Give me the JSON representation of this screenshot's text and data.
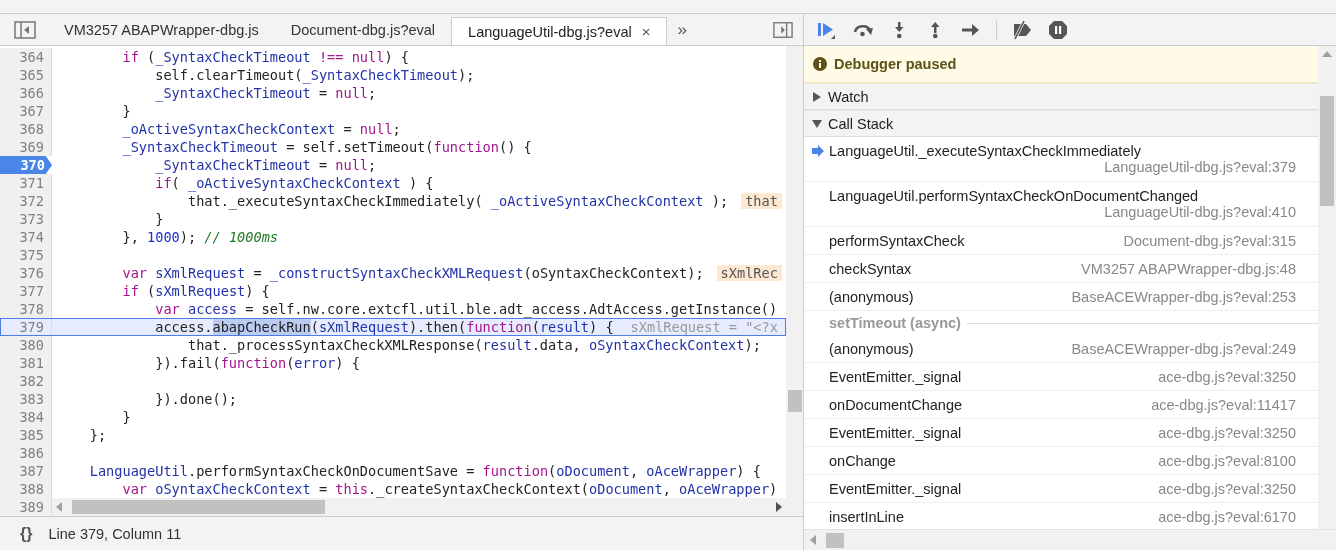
{
  "editor_tabs": [
    {
      "label": "VM3257 ABAPWrapper-dbg.js",
      "selected": false
    },
    {
      "label": "Document-dbg.js?eval",
      "selected": false
    },
    {
      "label": "LanguageUtil-dbg.js?eval",
      "selected": true,
      "close": "×"
    }
  ],
  "more_tabs": "»",
  "code": [
    {
      "number": "364",
      "breakpoint": false,
      "current": false,
      "segments": [
        {
          "text": "        if",
          "kind": "keyword"
        },
        {
          "text": " (",
          "kind": "plain"
        },
        {
          "text": "_SyntaxCheckTimeout",
          "kind": "variable"
        },
        {
          "text": " !== null",
          "kind": "keyword"
        },
        {
          "text": ") {",
          "kind": "plain"
        }
      ]
    },
    {
      "number": "365",
      "breakpoint": false,
      "current": false,
      "segments": [
        {
          "text": "            self.clearTimeout(",
          "kind": "plain"
        },
        {
          "text": "_SyntaxCheckTimeout",
          "kind": "variable"
        },
        {
          "text": ");",
          "kind": "plain"
        }
      ]
    },
    {
      "number": "366",
      "breakpoint": false,
      "current": false,
      "segments": [
        {
          "text": "            _SyntaxCheckTimeout",
          "kind": "variable"
        },
        {
          "text": " = ",
          "kind": "plain"
        },
        {
          "text": "null",
          "kind": "keyword"
        },
        {
          "text": ";",
          "kind": "plain"
        }
      ]
    },
    {
      "number": "367",
      "breakpoint": false,
      "current": false,
      "segments": [
        {
          "text": "        }",
          "kind": "plain"
        }
      ]
    },
    {
      "number": "368",
      "breakpoint": false,
      "current": false,
      "segments": [
        {
          "text": "        _oActiveSyntaxCheckContext",
          "kind": "variable"
        },
        {
          "text": " = ",
          "kind": "plain"
        },
        {
          "text": "null",
          "kind": "keyword"
        },
        {
          "text": ";",
          "kind": "plain"
        }
      ]
    },
    {
      "number": "369",
      "breakpoint": false,
      "current": false,
      "segments": [
        {
          "text": "        _SyntaxCheckTimeout",
          "kind": "variable"
        },
        {
          "text": " = self.setTimeout(",
          "kind": "plain"
        },
        {
          "text": "function",
          "kind": "keyword"
        },
        {
          "text": "() {",
          "kind": "plain"
        }
      ]
    },
    {
      "number": "370",
      "breakpoint": true,
      "current": false,
      "segments": [
        {
          "text": "            _SyntaxCheckTimeout",
          "kind": "variable"
        },
        {
          "text": " = ",
          "kind": "plain"
        },
        {
          "text": "null",
          "kind": "keyword"
        },
        {
          "text": ";",
          "kind": "plain"
        }
      ]
    },
    {
      "number": "371",
      "breakpoint": false,
      "current": false,
      "segments": [
        {
          "text": "            if",
          "kind": "keyword"
        },
        {
          "text": "( ",
          "kind": "plain"
        },
        {
          "text": "_oActiveSyntaxCheckContext",
          "kind": "variable"
        },
        {
          "text": " ) {",
          "kind": "plain"
        }
      ]
    },
    {
      "number": "372",
      "breakpoint": false,
      "current": false,
      "segments": [
        {
          "text": "                that._executeSyntaxCheckImmediately( ",
          "kind": "plain"
        },
        {
          "text": "_oActiveSyntaxCheckContext",
          "kind": "variable"
        },
        {
          "text": " );",
          "kind": "plain"
        }
      ],
      "inline_value": "that"
    },
    {
      "number": "373",
      "breakpoint": false,
      "current": false,
      "segments": [
        {
          "text": "            }",
          "kind": "plain"
        }
      ]
    },
    {
      "number": "374",
      "breakpoint": false,
      "current": false,
      "segments": [
        {
          "text": "        }, ",
          "kind": "plain"
        },
        {
          "text": "1000",
          "kind": "number"
        },
        {
          "text": "); ",
          "kind": "plain"
        },
        {
          "text": "// 1000ms",
          "kind": "comment"
        }
      ]
    },
    {
      "number": "375",
      "breakpoint": false,
      "current": false
    },
    {
      "number": "376",
      "breakpoint": false,
      "current": false,
      "segments": [
        {
          "text": "        var",
          "kind": "keyword"
        },
        {
          "text": " sXmlRequest",
          "kind": "variable"
        },
        {
          "text": " = ",
          "kind": "plain"
        },
        {
          "text": "_constructSyntaxCheckXMLRequest",
          "kind": "variable"
        },
        {
          "text": "(oSyntaxCheckContext);",
          "kind": "plain"
        }
      ],
      "inline_value": "sXmlRec"
    },
    {
      "number": "377",
      "breakpoint": false,
      "current": false,
      "segments": [
        {
          "text": "        if",
          "kind": "keyword"
        },
        {
          "text": " (",
          "kind": "plain"
        },
        {
          "text": "sXmlRequest",
          "kind": "variable"
        },
        {
          "text": ") {",
          "kind": "plain"
        }
      ]
    },
    {
      "number": "378",
      "breakpoint": false,
      "current": false,
      "segments": [
        {
          "text": "            var",
          "kind": "keyword"
        },
        {
          "text": " access",
          "kind": "variable"
        },
        {
          "text": " = self.nw.core.extcfl.util.ble.adt_access.AdtAccess.getInstance()",
          "kind": "plain"
        }
      ]
    },
    {
      "number": "379",
      "breakpoint": false,
      "current": true,
      "segments": [
        {
          "text": "            access.",
          "kind": "plain"
        },
        {
          "text": "abapCheckRun",
          "kind": "selection"
        },
        {
          "text": "(",
          "kind": "plain"
        },
        {
          "text": "sXmlRequest",
          "kind": "variable"
        },
        {
          "text": ").then(",
          "kind": "plain"
        },
        {
          "text": "function",
          "kind": "keyword"
        },
        {
          "text": "(",
          "kind": "plain"
        },
        {
          "text": "result",
          "kind": "variable"
        },
        {
          "text": ") {",
          "kind": "plain"
        }
      ],
      "inline_value": "sXmlRequest = \"<?x"
    },
    {
      "number": "380",
      "breakpoint": false,
      "current": false,
      "segments": [
        {
          "text": "                that._processSyntaxCheckXMLResponse(",
          "kind": "plain"
        },
        {
          "text": "result",
          "kind": "variable"
        },
        {
          "text": ".data, ",
          "kind": "plain"
        },
        {
          "text": "oSyntaxCheckContext",
          "kind": "variable"
        },
        {
          "text": ");",
          "kind": "plain"
        }
      ]
    },
    {
      "number": "381",
      "breakpoint": false,
      "current": false,
      "segments": [
        {
          "text": "            }).fail(",
          "kind": "plain"
        },
        {
          "text": "function",
          "kind": "keyword"
        },
        {
          "text": "(",
          "kind": "plain"
        },
        {
          "text": "error",
          "kind": "variable"
        },
        {
          "text": ") {",
          "kind": "plain"
        }
      ]
    },
    {
      "number": "382",
      "breakpoint": false,
      "current": false
    },
    {
      "number": "383",
      "breakpoint": false,
      "current": false,
      "segments": [
        {
          "text": "            }).done();",
          "kind": "plain"
        }
      ]
    },
    {
      "number": "384",
      "breakpoint": false,
      "current": false,
      "segments": [
        {
          "text": "        }",
          "kind": "plain"
        }
      ]
    },
    {
      "number": "385",
      "breakpoint": false,
      "current": false,
      "segments": [
        {
          "text": "    };",
          "kind": "plain"
        }
      ]
    },
    {
      "number": "386",
      "breakpoint": false,
      "current": false
    },
    {
      "number": "387",
      "breakpoint": false,
      "current": false,
      "segments": [
        {
          "text": "    LanguageUtil",
          "kind": "variable"
        },
        {
          "text": ".performSyntaxCheckOnDocumentSave = ",
          "kind": "plain"
        },
        {
          "text": "function",
          "kind": "keyword"
        },
        {
          "text": "(",
          "kind": "plain"
        },
        {
          "text": "oDocument",
          "kind": "variable"
        },
        {
          "text": ", ",
          "kind": "plain"
        },
        {
          "text": "oAceWrapper",
          "kind": "variable"
        },
        {
          "text": ") {",
          "kind": "plain"
        }
      ]
    },
    {
      "number": "388",
      "breakpoint": false,
      "current": false,
      "segments": [
        {
          "text": "        var",
          "kind": "keyword"
        },
        {
          "text": " oSyntaxCheckContext",
          "kind": "variable"
        },
        {
          "text": " = ",
          "kind": "plain"
        },
        {
          "text": "this",
          "kind": "keyword"
        },
        {
          "text": "._createSyntaxCheckContext(",
          "kind": "plain"
        },
        {
          "text": "oDocument",
          "kind": "variable"
        },
        {
          "text": ", ",
          "kind": "plain"
        },
        {
          "text": "oAceWrapper",
          "kind": "variable"
        },
        {
          "text": ")",
          "kind": "plain"
        }
      ]
    },
    {
      "number": "389",
      "breakpoint": false,
      "current": false
    }
  ],
  "status_bar": {
    "pretty_print": "{}",
    "position": "Line 379, Column 11"
  },
  "paused_banner": "Debugger paused",
  "sections": [
    {
      "title": "Watch",
      "expanded": false
    },
    {
      "title": "Call Stack",
      "expanded": true
    }
  ],
  "call_stack": [
    {
      "kind": "frame",
      "name": "LanguageUtil._executeSyntaxCheckImmediately",
      "location": "LanguageUtil-dbg.js?eval:379",
      "selected": true
    },
    {
      "kind": "frame",
      "name": "LanguageUtil.performSyntaxCheckOnDocumentChanged",
      "location": "LanguageUtil-dbg.js?eval:410",
      "selected": false
    },
    {
      "kind": "frame",
      "name": "performSyntaxCheck",
      "location": "Document-dbg.js?eval:315",
      "selected": false
    },
    {
      "kind": "frame",
      "name": "checkSyntax",
      "location": "VM3257 ABAPWrapper-dbg.js:48",
      "selected": false
    },
    {
      "kind": "frame",
      "name": "(anonymous)",
      "location": "BaseACEWrapper-dbg.js?eval:253",
      "selected": false
    },
    {
      "kind": "async",
      "name": "setTimeout (async)"
    },
    {
      "kind": "frame",
      "name": "(anonymous)",
      "location": "BaseACEWrapper-dbg.js?eval:249",
      "selected": false
    },
    {
      "kind": "frame",
      "name": "EventEmitter._signal",
      "location": "ace-dbg.js?eval:3250",
      "selected": false
    },
    {
      "kind": "frame",
      "name": "onDocumentChange",
      "location": "ace-dbg.js?eval:11417",
      "selected": false
    },
    {
      "kind": "frame",
      "name": "EventEmitter._signal",
      "location": "ace-dbg.js?eval:3250",
      "selected": false
    },
    {
      "kind": "frame",
      "name": "onChange",
      "location": "ace-dbg.js?eval:8100",
      "selected": false
    },
    {
      "kind": "frame",
      "name": "EventEmitter._signal",
      "location": "ace-dbg.js?eval:3250",
      "selected": false
    },
    {
      "kind": "frame",
      "name": "insertInLine",
      "location": "ace-dbg.js?eval:6170",
      "selected": false
    }
  ]
}
